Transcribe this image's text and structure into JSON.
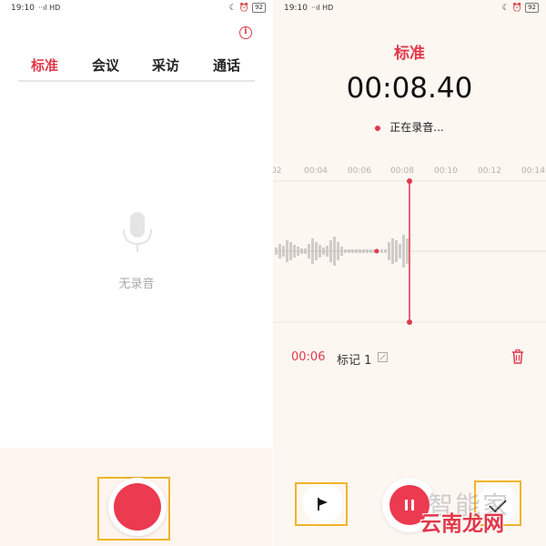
{
  "left": {
    "status_time": "19:10",
    "status_signal": "··ıl HD",
    "battery": "92",
    "tabs": [
      "标准",
      "会议",
      "采访",
      "通话"
    ],
    "active_tab": "标准",
    "empty_text": "无录音",
    "icons": [
      "info-icon",
      "microphone-icon",
      "record-button"
    ]
  },
  "right": {
    "status_time": "19:10",
    "status_signal": "··ıl HD",
    "battery": "92",
    "mode_title": "标准",
    "timer": "00:08.40",
    "recording_status": "正在录音...",
    "ticks": [
      "02",
      "00:04",
      "00:06",
      "00:08",
      "00:10",
      "00:12",
      "00:14"
    ],
    "mark": {
      "time": "00:06",
      "label": "标记 1"
    },
    "icons": [
      "edit-icon",
      "trash-icon",
      "flag-icon",
      "pause-icon",
      "check-icon"
    ]
  },
  "watermark": {
    "top": "智能家",
    "bottom": "云南龙网"
  },
  "colors": {
    "accent": "#e0394a",
    "record_red": "#ec3a50",
    "highlight_frame": "#f0b429",
    "right_bg": "#fdf7f2"
  }
}
